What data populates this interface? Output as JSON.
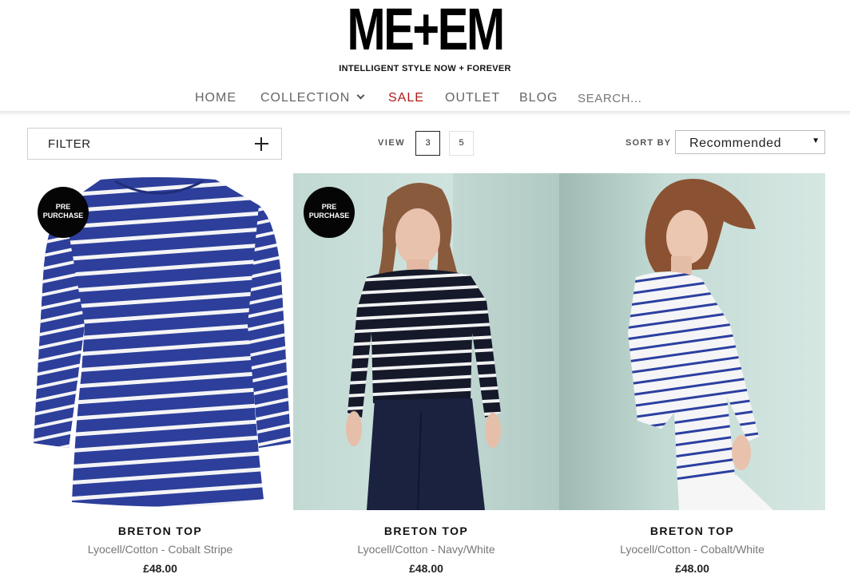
{
  "brand": {
    "logo_text": "ME+EM",
    "tagline": "INTELLIGENT STYLE NOW + FOREVER"
  },
  "nav": {
    "items": [
      {
        "label": "HOME"
      },
      {
        "label": "COLLECTION"
      },
      {
        "label": "SALE"
      },
      {
        "label": "OUTLET"
      },
      {
        "label": "BLOG"
      }
    ],
    "search_placeholder": "SEARCH..."
  },
  "toolbar": {
    "filter_label": "FILTER",
    "view_label": "VIEW",
    "view_options": [
      "3",
      "5"
    ],
    "view_selected": "3",
    "sort_label": "SORT BY",
    "sort_value": "Recommended"
  },
  "colors": {
    "sale": "#b01a1a",
    "badge": "#050505",
    "cobalt": "#2c3f9a",
    "navy": "#1b2135",
    "studio_bg": "#c6dcd7"
  },
  "products": [
    {
      "badge_line1": "PRE",
      "badge_line2": "PURCHASE",
      "name": "BRETON TOP",
      "variant": "Lyocell/Cotton - Cobalt Stripe",
      "price": "£48.00"
    },
    {
      "badge_line1": "PRE",
      "badge_line2": "PURCHASE",
      "name": "BRETON TOP",
      "variant": "Lyocell/Cotton - Navy/White",
      "price": "£48.00"
    },
    {
      "name": "BRETON TOP",
      "variant": "Lyocell/Cotton - Cobalt/White",
      "price": "£48.00"
    }
  ]
}
